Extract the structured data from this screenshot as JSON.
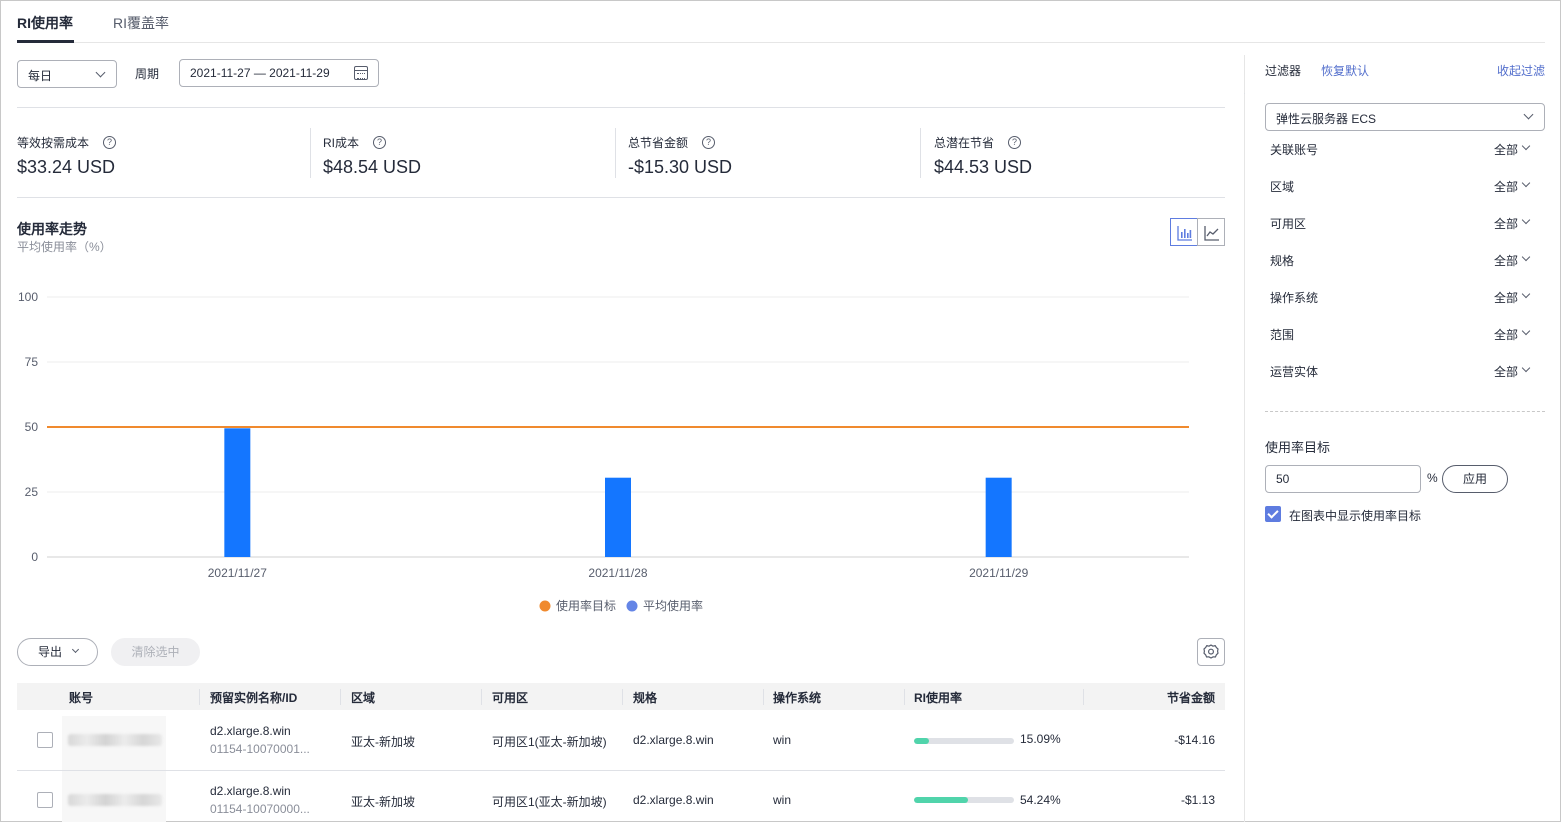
{
  "tabs": [
    {
      "label": "RI使用率",
      "active": true
    },
    {
      "label": "RI覆盖率",
      "active": false
    }
  ],
  "controls": {
    "granularity": "每日",
    "period_label": "周期",
    "date_range": "2021-11-27 — 2021-11-29"
  },
  "metrics": [
    {
      "label": "等效按需成本",
      "value": "$33.24 USD"
    },
    {
      "label": "RI成本",
      "value": "$48.54 USD"
    },
    {
      "label": "总节省金额",
      "value": "-$15.30 USD"
    },
    {
      "label": "总潜在节省",
      "value": "$44.53 USD"
    }
  ],
  "trend": {
    "title": "使用率走势",
    "subtitle": "平均使用率（%）"
  },
  "chart_data": {
    "type": "bar",
    "categories": [
      "2021/11/27",
      "2021/11/28",
      "2021/11/29"
    ],
    "series": [
      {
        "name": "平均使用率",
        "type": "bar",
        "values": [
          49.5,
          30.5,
          30.5
        ],
        "color": "#1476ff"
      },
      {
        "name": "使用率目标",
        "type": "line",
        "values": [
          50,
          50,
          50
        ],
        "color": "#f08a2e"
      }
    ],
    "yticks": [
      "100",
      "75",
      "50",
      "25",
      "0"
    ],
    "ylim": [
      0,
      100
    ],
    "grid": true,
    "legend_position": "bottom-center",
    "legend": [
      {
        "name": "使用率目标",
        "color": "#f08a2e"
      },
      {
        "name": "平均使用率",
        "color": "#6485e6"
      }
    ]
  },
  "table_toolbar": {
    "export_label": "导出",
    "clear_label": "清除选中"
  },
  "table": {
    "columns": [
      "账号",
      "预留实例名称/ID",
      "区域",
      "可用区",
      "规格",
      "操作系统",
      "RI使用率",
      "节省金额"
    ],
    "rows": [
      {
        "name": "d2.xlarge.8.win",
        "id": "01154-10070001...",
        "region": "亚太-新加坡",
        "az": "可用区1(亚太-新加坡)",
        "spec": "d2.xlarge.8.win",
        "os": "win",
        "usage": "15.09%",
        "usage_pct": 15.09,
        "saving": "-$14.16"
      },
      {
        "name": "d2.xlarge.8.win",
        "id": "01154-10070000...",
        "region": "亚太-新加坡",
        "az": "可用区1(亚太-新加坡)",
        "spec": "d2.xlarge.8.win",
        "os": "win",
        "usage": "54.24%",
        "usage_pct": 54.24,
        "saving": "-$1.13"
      }
    ]
  },
  "filter": {
    "title": "过滤器",
    "reset": "恢复默认",
    "collapse": "收起过滤",
    "service": "弹性云服务器 ECS",
    "rows": [
      {
        "label": "关联账号",
        "value": "全部"
      },
      {
        "label": "区域",
        "value": "全部"
      },
      {
        "label": "可用区",
        "value": "全部"
      },
      {
        "label": "规格",
        "value": "全部"
      },
      {
        "label": "操作系统",
        "value": "全部"
      },
      {
        "label": "范围",
        "value": "全部"
      },
      {
        "label": "运营实体",
        "value": "全部"
      }
    ],
    "target_label": "使用率目标",
    "target_value": "50",
    "pct_symbol": "%",
    "apply": "应用",
    "show_target": "在图表中显示使用率目标"
  }
}
